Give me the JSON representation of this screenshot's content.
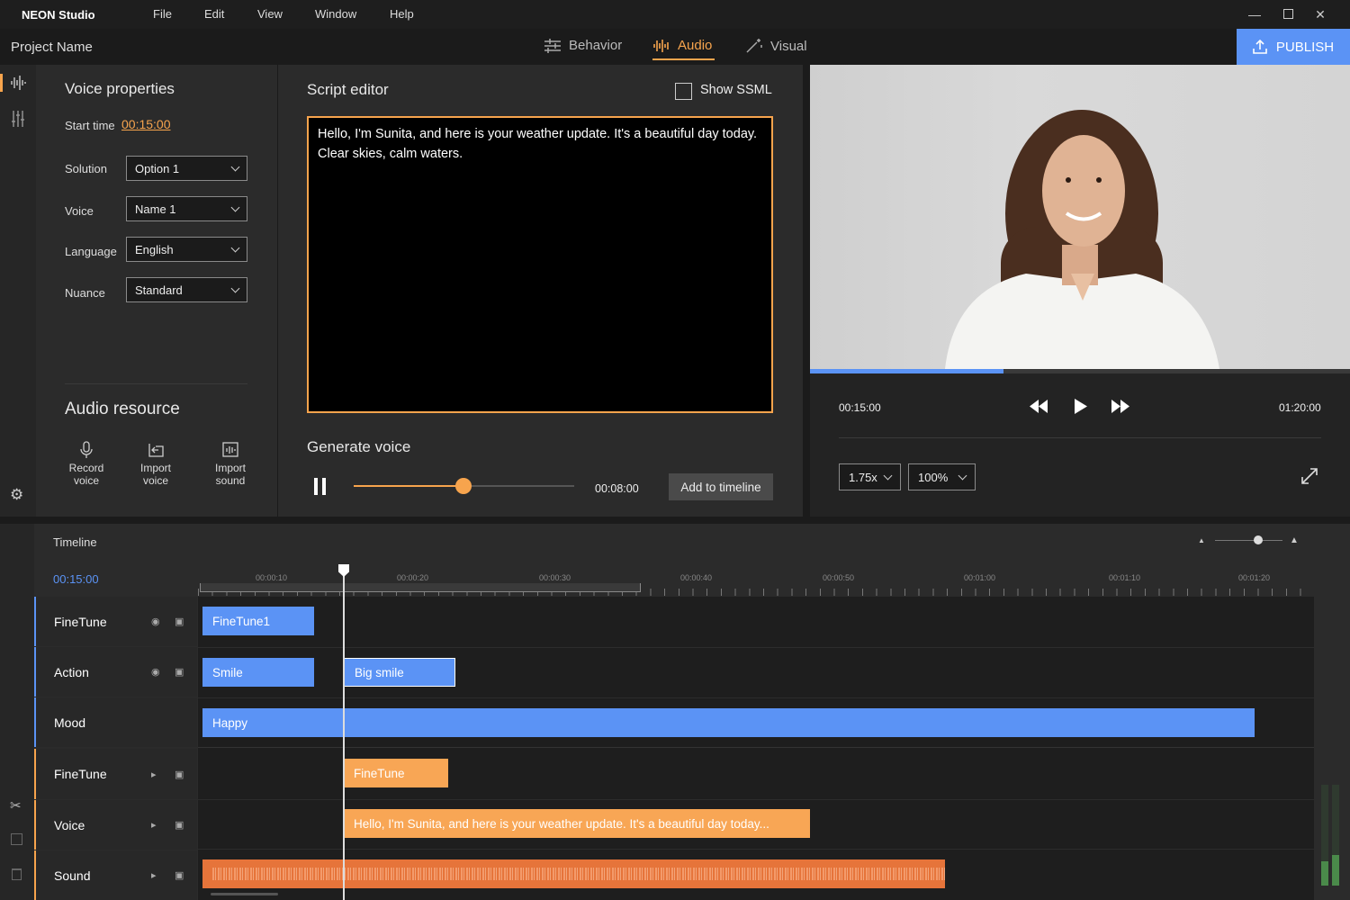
{
  "app": {
    "title": "NEON Studio"
  },
  "menu": [
    "File",
    "Edit",
    "View",
    "Window",
    "Help"
  ],
  "header": {
    "project_name": "Project Name",
    "tabs": [
      "Behavior",
      "Audio",
      "Visual"
    ],
    "active_tab": "Audio",
    "publish_label": "PUBLISH"
  },
  "voice_props": {
    "title": "Voice properties",
    "start_time_label": "Start time",
    "start_time_value": "00:15:00",
    "fields": [
      {
        "label": "Solution",
        "value": "Option 1"
      },
      {
        "label": "Voice",
        "value": "Name 1"
      },
      {
        "label": "Language",
        "value": "English"
      },
      {
        "label": "Nuance",
        "value": "Standard"
      }
    ]
  },
  "audio_resource": {
    "title": "Audio resource",
    "buttons": [
      {
        "line1": "Record",
        "line2": "voice",
        "icon": "microphone-icon"
      },
      {
        "line1": "Import",
        "line2": "voice",
        "icon": "import-icon"
      },
      {
        "line1": "Import",
        "line2": "sound",
        "icon": "sound-file-icon"
      }
    ]
  },
  "script_editor": {
    "title": "Script editor",
    "show_ssml_label": "Show SSML",
    "text": "Hello, I'm Sunita, and here is your weather update. It's a beautiful day today. Clear skies, calm waters."
  },
  "generate_voice": {
    "title": "Generate voice",
    "time": "00:08:00",
    "progress": 0.5,
    "add_label": "Add to timeline"
  },
  "preview": {
    "current_time": "00:15:00",
    "total_time": "01:20:00",
    "progress": 0.36,
    "speed": "1.75x",
    "zoom": "100%"
  },
  "timeline": {
    "title": "Timeline",
    "current_time": "00:15:00",
    "ticks": [
      "00:00:10",
      "00:00:20",
      "00:00:30",
      "00:00:40",
      "00:00:50",
      "00:01:00",
      "00:01:10",
      "00:01:20"
    ],
    "tracks": [
      {
        "label": "FineTune",
        "group": "behavior"
      },
      {
        "label": "Action",
        "group": "behavior"
      },
      {
        "label": "Mood",
        "group": "behavior"
      },
      {
        "label": "FineTune",
        "group": "audio"
      },
      {
        "label": "Voice",
        "group": "audio"
      },
      {
        "label": "Sound",
        "group": "audio"
      }
    ],
    "clips": {
      "finetune1": "FineTune1",
      "smile": "Smile",
      "big_smile": "Big smile",
      "happy": "Happy",
      "finetune_audio": "FineTune",
      "voice": "Hello, I'm Sunita, and here is your weather update.  It's a beautiful day today..."
    }
  },
  "colors": {
    "accent": "#f7a44d",
    "blue": "#5b93f5",
    "publish": "#5b93f5"
  }
}
